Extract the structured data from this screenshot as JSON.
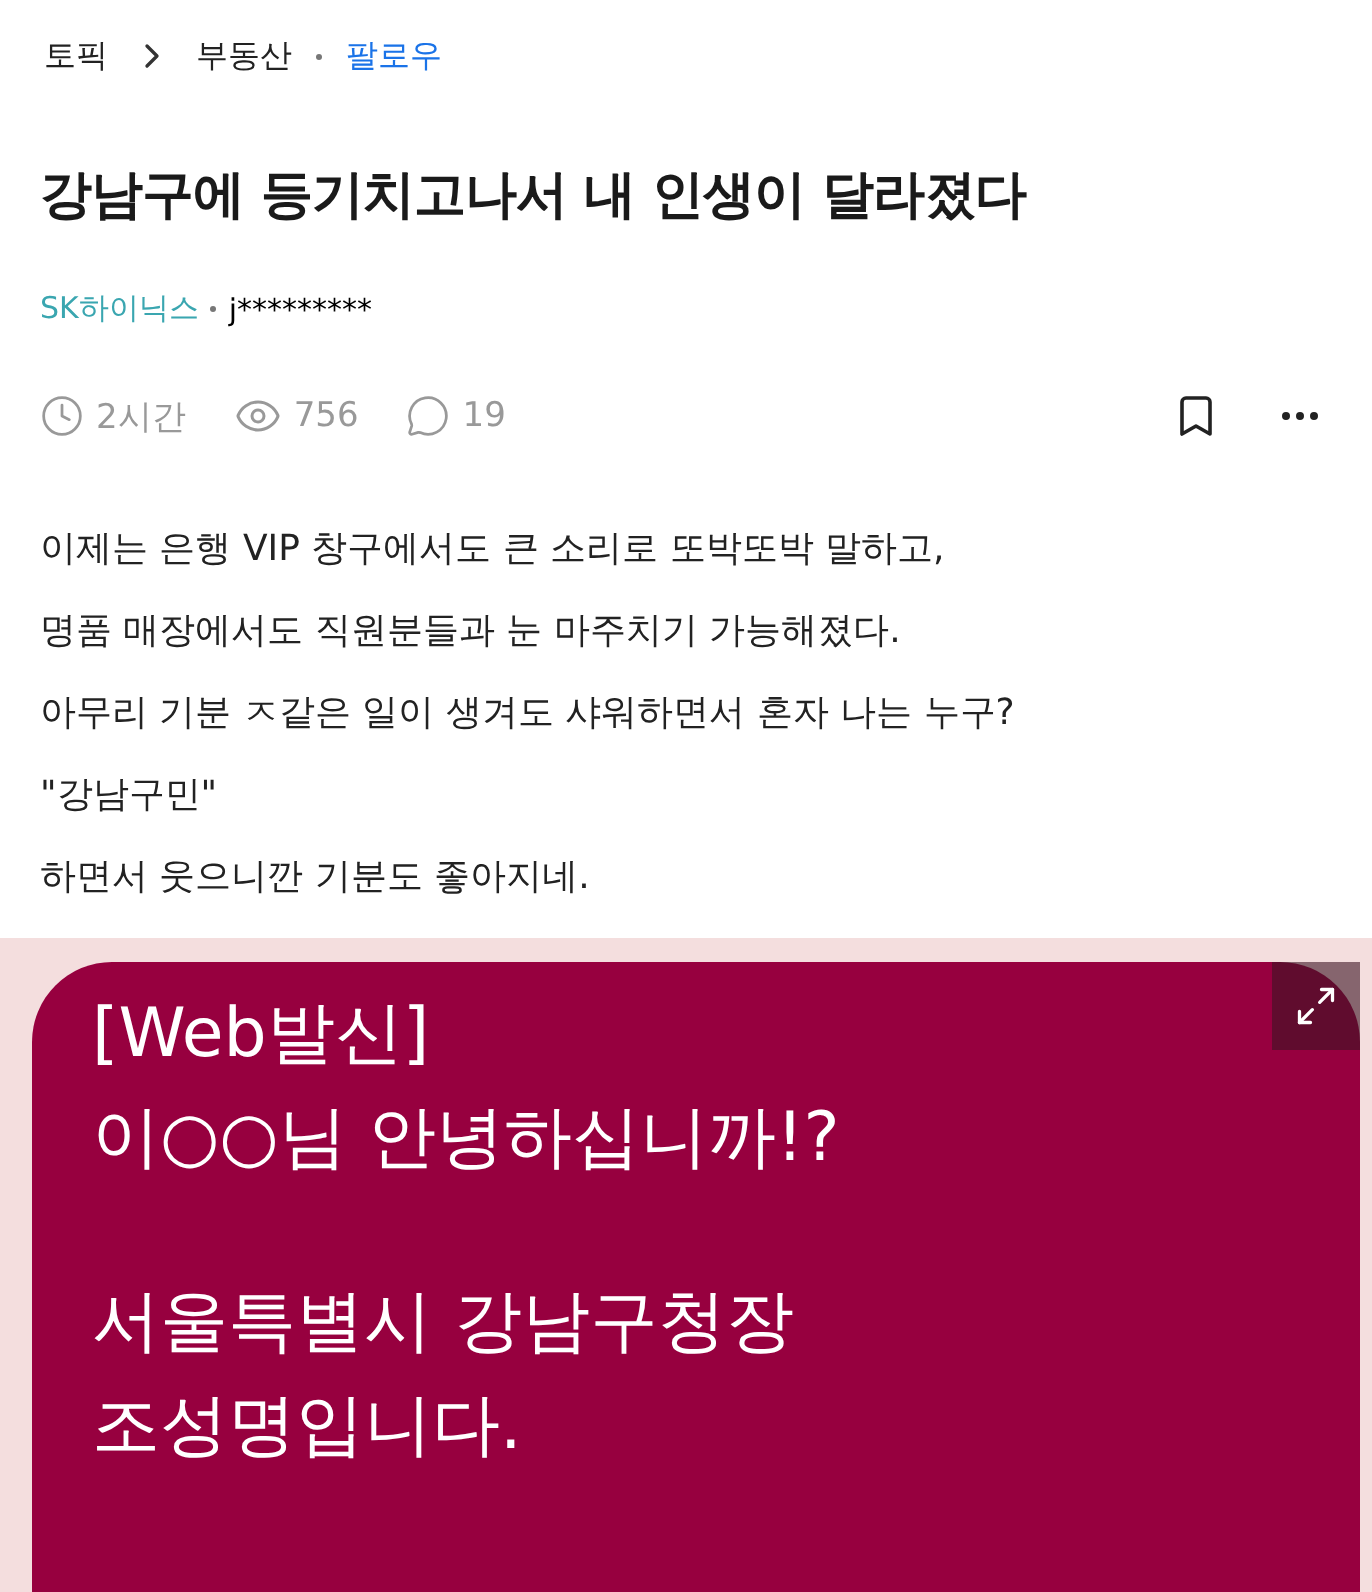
{
  "breadcrumb": {
    "topic": "토픽",
    "category": "부동산",
    "follow": "팔로우"
  },
  "title": "강남구에 등기치고나서 내 인생이 달라졌다",
  "author": {
    "company": "SK하이닉스",
    "name": "j*********"
  },
  "stats": {
    "time": "2시간",
    "views": "756",
    "comments": "19"
  },
  "body": [
    "이제는 은행 VIP 창구에서도 큰 소리로 또박또박 말하고,",
    "명품 매장에서도 직원분들과 눈 마주치기 가능해졌다.",
    "아무리 기분 ㅈ같은 일이 생겨도 샤워하면서 혼자 나는 누구?",
    "\"강남구민\"",
    "하면서 웃으니깐 기분도 좋아지네."
  ],
  "message": {
    "paragraphs": [
      [
        "[Web발신]",
        "이○○님 안녕하십니까!?"
      ],
      [
        "서울특별시 강남구청장",
        "조성명입니다."
      ]
    ]
  }
}
